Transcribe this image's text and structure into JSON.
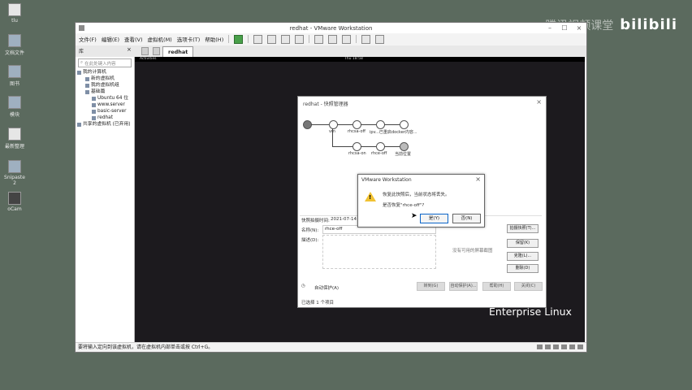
{
  "desktop": {
    "icons": [
      {
        "label": "tlu",
        "kind": "doc"
      },
      {
        "label": "文档文件",
        "kind": "cfg"
      },
      {
        "label": "图书",
        "kind": "cfg"
      },
      {
        "label": "模块",
        "kind": "cfg"
      },
      {
        "label": "最新整理",
        "kind": "doc"
      },
      {
        "label": "Snipaste 2",
        "kind": "cfg"
      },
      {
        "label": "oCam",
        "kind": "dark"
      }
    ],
    "watermark_text": "腾讯视频课堂",
    "watermark_logo": "bilibili"
  },
  "vmware": {
    "title": "redhat - VMware Workstation",
    "menus": [
      "文件(F)",
      "编辑(E)",
      "查看(V)",
      "虚拟机(M)",
      "选项卡(T)",
      "帮助(H)"
    ],
    "library_header": "库",
    "library_close": "×",
    "search_placeholder": "在此处键入内容",
    "tree": [
      "我的计算机",
      "新的虚拟机",
      "我的虚拟机组",
      "基础篇",
      "Ubuntu 64 位",
      "www.server",
      "basic-server",
      "redhat",
      "共享的虚拟机 (已弃用)"
    ],
    "vm_tab": "redhat",
    "gnome_activities": "Activities",
    "gnome_clock": "Thu 18:58",
    "rh_small": "redhat",
    "rh_text": "Enterprise Linux",
    "status_text": "要将输入定向到该虚拟机，请在虚拟机内部单击或按 Ctrl+G。"
  },
  "snapshot_manager": {
    "title": "redhat - 快照管理器",
    "close": "×",
    "nodes": [
      "vm",
      "rhcsa-off",
      "ipv...已重启",
      "docker内容...",
      "rhcsa-on",
      "rhce-off",
      "当前位置"
    ],
    "taken_label": "快照拍摄时间:",
    "taken_value": "2021-07-14 18:",
    "name_label": "名称(N):",
    "name_value": "rhce-off",
    "desc_label": "描述(D):",
    "info_text": "没有可用的屏幕截图",
    "right_buttons": [
      "拍摄快照(T)...",
      "保留(K)",
      "克隆(L)...",
      "删除(D)"
    ],
    "autoprotect": "自动保护(A)",
    "bottom_buttons": [
      "转到(G)",
      "自动保护(A)...",
      "帮助(H)",
      "关闭(C)"
    ],
    "bottom_hint": "已选择 1 个项目"
  },
  "dialog": {
    "title": "VMware Workstation",
    "close": "×",
    "line1": "恢复此快照后，当前状态将丢失。",
    "line2": "是否恢复\"rhce-off\"?",
    "yes": "是(Y)",
    "no": "否(N)"
  },
  "colors": {
    "desktop_bg": "#5b6a5e",
    "console_bg": "#1c1a1e",
    "warning": "#f1c232"
  }
}
